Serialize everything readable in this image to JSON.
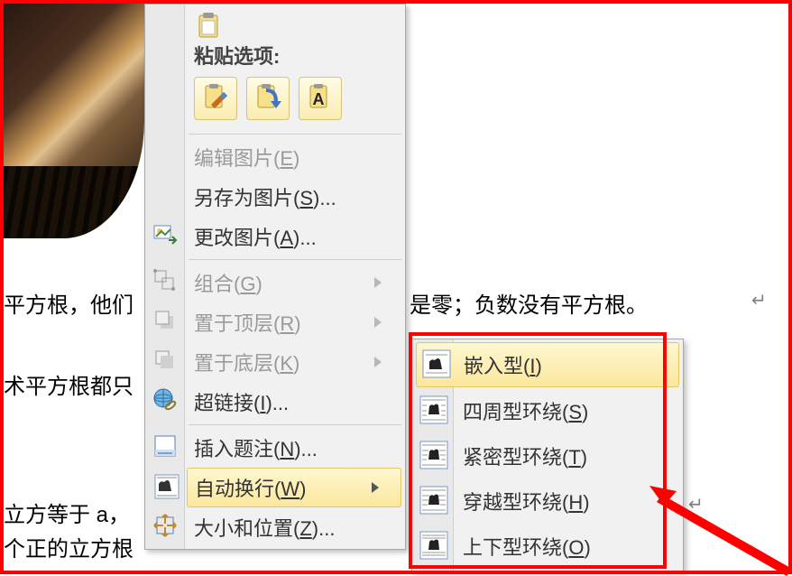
{
  "paste_section": {
    "header": "粘贴选项:",
    "options": [
      {
        "name": "paste-keep-source-formatting",
        "icon": "clipboard-brush-icon"
      },
      {
        "name": "paste-merge-formatting",
        "icon": "clipboard-arrow-icon"
      },
      {
        "name": "paste-text-only",
        "icon": "clipboard-letter-a-icon"
      }
    ]
  },
  "menu": [
    {
      "id": "edit-picture",
      "label": "编辑图片(E)",
      "accel": "E",
      "enabled": false,
      "icon": null,
      "submenu": false
    },
    {
      "id": "save-as-pic",
      "label": "另存为图片(S)...",
      "accel": "S",
      "enabled": true,
      "icon": null,
      "submenu": false
    },
    {
      "id": "change-pic",
      "label": "更改图片(A)...",
      "accel": "A",
      "enabled": true,
      "icon": "change-picture-icon",
      "submenu": false
    },
    {
      "id": "sep1",
      "separator": true
    },
    {
      "id": "group",
      "label": "组合(G)",
      "accel": "G",
      "enabled": false,
      "icon": "group-icon",
      "submenu": true
    },
    {
      "id": "bring-front",
      "label": "置于顶层(R)",
      "accel": "R",
      "enabled": false,
      "icon": "bring-front-icon",
      "submenu": true
    },
    {
      "id": "send-back",
      "label": "置于底层(K)",
      "accel": "K",
      "enabled": false,
      "icon": "send-back-icon",
      "submenu": true
    },
    {
      "id": "hyperlink",
      "label": "超链接(I)...",
      "accel": "I",
      "enabled": true,
      "icon": "hyperlink-icon",
      "submenu": false
    },
    {
      "id": "sep2",
      "separator": true
    },
    {
      "id": "insert-caption",
      "label": "插入题注(N)...",
      "accel": "N",
      "enabled": true,
      "icon": "caption-icon",
      "submenu": false
    },
    {
      "id": "wrap-text",
      "label": "自动换行(W)",
      "accel": "W",
      "enabled": true,
      "icon": "wrap-text-icon",
      "submenu": true,
      "highlighted": true
    },
    {
      "id": "size-position",
      "label": "大小和位置(Z)...",
      "accel": "Z",
      "enabled": true,
      "icon": "size-position-icon",
      "submenu": false
    }
  ],
  "wrap_submenu": [
    {
      "id": "wrap-inline",
      "label": "嵌入型(I)",
      "accel": "I",
      "icon": "wrap-inline-icon",
      "highlighted": true
    },
    {
      "id": "wrap-square",
      "label": "四周型环绕(S)",
      "accel": "S",
      "icon": "wrap-square-icon"
    },
    {
      "id": "wrap-tight",
      "label": "紧密型环绕(T)",
      "accel": "T",
      "icon": "wrap-tight-icon"
    },
    {
      "id": "wrap-through",
      "label": "穿越型环绕(H)",
      "accel": "H",
      "icon": "wrap-through-icon"
    },
    {
      "id": "wrap-topbottom",
      "label": "上下型环绕(O)",
      "accel": "O",
      "icon": "wrap-topbottom-icon"
    }
  ],
  "document_text": {
    "line1_left": "平方根，他们",
    "line1_right": "是零；负数没有平方根。",
    "line2": "术平方根都只",
    "line3": "立方等于 a，",
    "line4": "个正的立方根"
  },
  "header_icon": "clipboard-paste-icon"
}
